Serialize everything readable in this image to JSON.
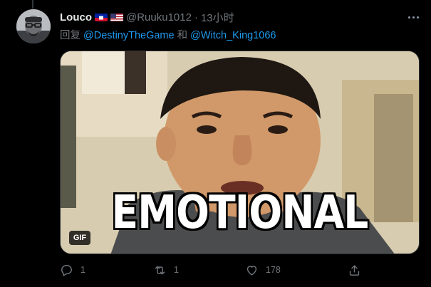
{
  "tweet": {
    "author_name": "Louco",
    "flags": [
      "haiti-flag-icon",
      "usa-flag-icon"
    ],
    "handle": "@Ruuku1012",
    "separator": "·",
    "time": "13小时",
    "reply_prefix": "回复",
    "mention_1": "@DestinyTheGame",
    "reply_conjunction": "和",
    "mention_2": "@Witch_King1066",
    "media": {
      "caption": "EMOTIONAL",
      "badge": "GIF"
    },
    "actions": {
      "reply_count": "1",
      "retweet_count": "1",
      "like_count": "178"
    }
  },
  "colors": {
    "background": "#000000",
    "text_primary": "#e7e9ea",
    "text_secondary": "#71767b",
    "link": "#1d9bf0"
  }
}
